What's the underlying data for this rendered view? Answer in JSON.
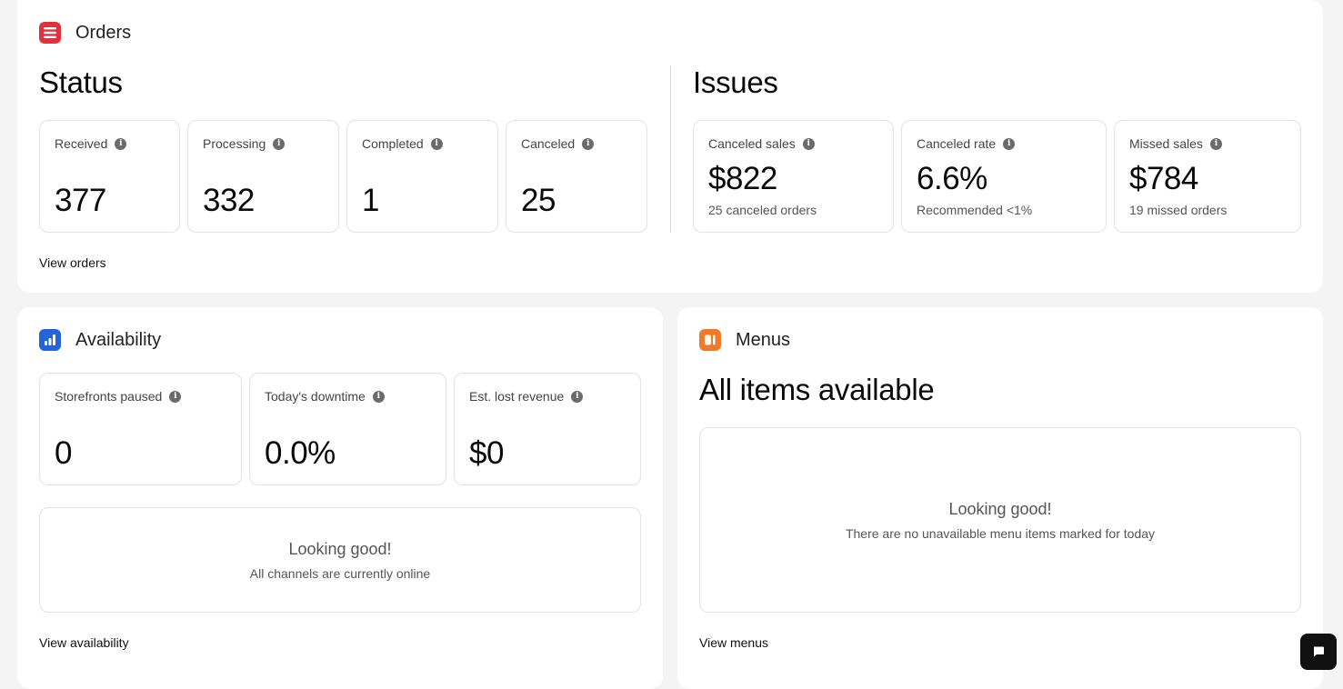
{
  "orders": {
    "title": "Orders",
    "status": {
      "heading": "Status",
      "metrics": [
        {
          "label": "Received",
          "value": "377"
        },
        {
          "label": "Processing",
          "value": "332"
        },
        {
          "label": "Completed",
          "value": "1"
        },
        {
          "label": "Canceled",
          "value": "25"
        }
      ]
    },
    "issues": {
      "heading": "Issues",
      "metrics": [
        {
          "label": "Canceled sales",
          "value": "$822",
          "sub": "25 canceled orders"
        },
        {
          "label": "Canceled rate",
          "value": "6.6%",
          "sub": "Recommended <1%"
        },
        {
          "label": "Missed sales",
          "value": "$784",
          "sub": "19 missed orders"
        }
      ]
    },
    "link": "View orders",
    "icon": "orders-stack-icon",
    "accent": "#e0323c"
  },
  "availability": {
    "title": "Availability",
    "metrics": [
      {
        "label": "Storefronts paused",
        "value": "0"
      },
      {
        "label": "Today's downtime",
        "value": "0.0%"
      },
      {
        "label": "Est. lost revenue",
        "value": "$0"
      }
    ],
    "empty": {
      "title": "Looking good!",
      "subtitle": "All channels are currently online"
    },
    "link": "View availability",
    "icon": "bar-chart-icon",
    "accent": "#2563d9"
  },
  "menus": {
    "title": "Menus",
    "heading": "All items available",
    "empty": {
      "title": "Looking good!",
      "subtitle": "There are no unavailable menu items marked for today"
    },
    "link": "View menus",
    "icon": "menu-icon",
    "accent": "#f07a2a"
  },
  "chat": {
    "icon": "chat-icon"
  }
}
